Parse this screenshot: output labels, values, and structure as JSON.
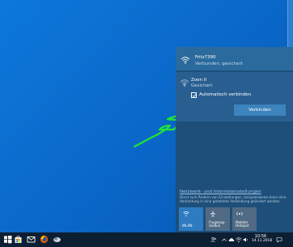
{
  "flyout": {
    "connected_network": {
      "name": "Fritz7390",
      "status": "Verbunden, gesichert",
      "icon": "wifi-icon"
    },
    "selected_network": {
      "name": "Zoen II",
      "status": "Gesichert",
      "icon": "wifi-icon",
      "auto_connect_label": "Automatisch verbinden",
      "auto_connect_checked": true,
      "connect_button": "Verbinden"
    },
    "settings_link": "Netzwerk- und Interneteinstellungen",
    "settings_description": "Dient zum Ändern von Einstellungen, beispielsweise kann eine Verbindung in eine getaktete Verbindung geändert werden.",
    "quick_actions": [
      {
        "label": "WLAN",
        "icon": "wifi-icon"
      },
      {
        "label": "Flugzeug-\nmodus",
        "icon": "airplane-icon"
      },
      {
        "label": "Mobiler\nHotspot",
        "icon": "hotspot-icon"
      }
    ]
  },
  "taskbar": {
    "pinned_icons": [
      "windows-start-icon",
      "store-icon",
      "mail-icon",
      "firefox-icon",
      "app-icon"
    ],
    "tray": {
      "icons": [
        "people-icon",
        "chevron-up-icon",
        "cloud-icon",
        "network-icon",
        "volume-icon"
      ],
      "time": "10:56",
      "date": "14.11.2018",
      "notification_icon": "notification-icon"
    }
  },
  "colors": {
    "desktop": "#0a6fd0",
    "flyout": "#1d4f7a",
    "connect_button": "#3d83bd",
    "annotation_arrow": "#22e23a",
    "taskbar": "#0d1f33"
  }
}
